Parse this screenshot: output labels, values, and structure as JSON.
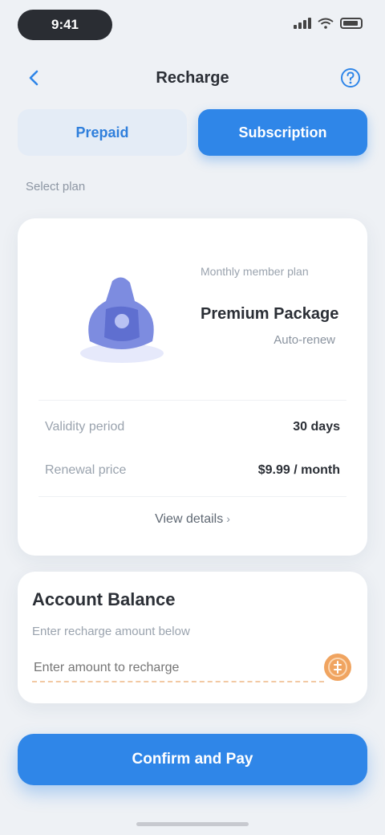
{
  "status_bar": {
    "time": "9:41"
  },
  "header": {
    "title": "Recharge"
  },
  "tabs": [
    {
      "label": "Prepaid"
    },
    {
      "label": "Subscription"
    }
  ],
  "section_label": "Select plan",
  "product": {
    "caption": "Monthly member plan",
    "name": "Premium Package",
    "subtitle": "Auto-renew"
  },
  "details": [
    {
      "label": "Validity period",
      "value": "30 days"
    },
    {
      "label": "Renewal price",
      "value": "$9.99 / month"
    }
  ],
  "card_link": "View details",
  "balance": {
    "title": "Account Balance",
    "subtitle": "Enter recharge amount below",
    "input_placeholder": "Enter amount to recharge"
  },
  "primary_button": "Confirm and Pay",
  "colors": {
    "primary": "#2f86e8",
    "accent_orange": "#e8954e",
    "illustration": "#6f7fd8"
  }
}
